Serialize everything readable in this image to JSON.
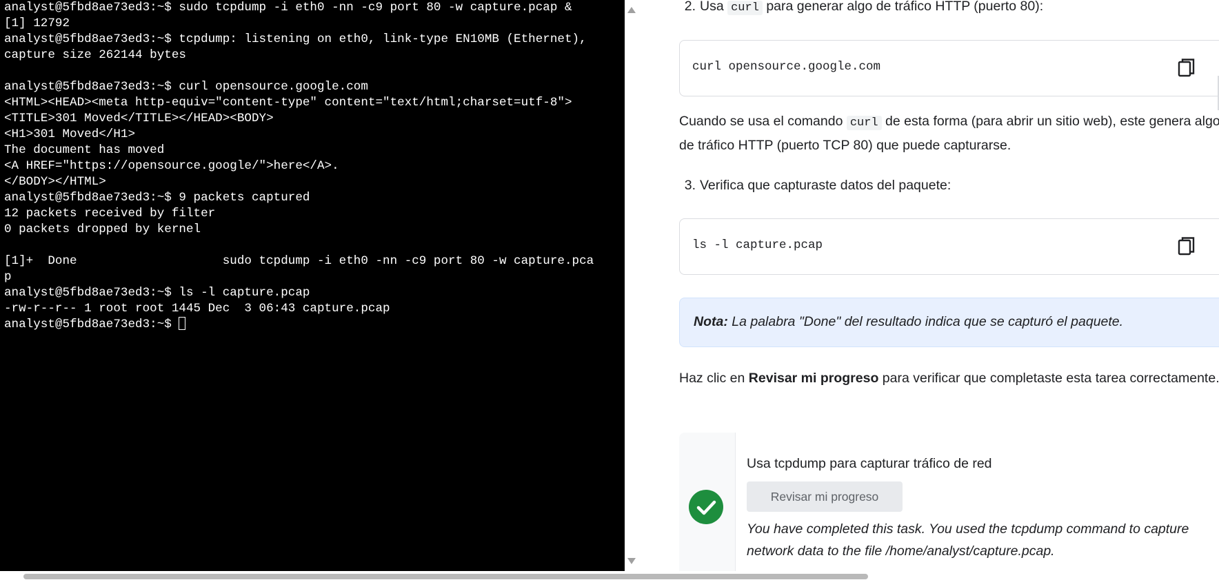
{
  "terminal": {
    "lines": [
      "analyst@5fbd8ae73ed3:~$ sudo tcpdump -i eth0 -nn -c9 port 80 -w capture.pcap &",
      "[1] 12792",
      "analyst@5fbd8ae73ed3:~$ tcpdump: listening on eth0, link-type EN10MB (Ethernet),",
      "capture size 262144 bytes",
      "",
      "analyst@5fbd8ae73ed3:~$ curl opensource.google.com",
      "<HTML><HEAD><meta http-equiv=\"content-type\" content=\"text/html;charset=utf-8\">",
      "<TITLE>301 Moved</TITLE></HEAD><BODY>",
      "<H1>301 Moved</H1>",
      "The document has moved",
      "<A HREF=\"https://opensource.google/\">here</A>.",
      "</BODY></HTML>",
      "analyst@5fbd8ae73ed3:~$ 9 packets captured",
      "12 packets received by filter",
      "0 packets dropped by kernel",
      "",
      "[1]+  Done                    sudo tcpdump -i eth0 -nn -c9 port 80 -w capture.pca",
      "p",
      "analyst@5fbd8ae73ed3:~$ ls -l capture.pcap",
      "-rw-r--r-- 1 root root 1445 Dec  3 06:43 capture.pcap"
    ],
    "prompt": "analyst@5fbd8ae73ed3:~$ "
  },
  "instructions": {
    "step2": {
      "number": "2.",
      "before": "Usa ",
      "code": "curl",
      "after": " para generar algo de tráfico HTTP (puerto 80):"
    },
    "codebox1": "curl opensource.google.com",
    "para1": {
      "before": "Cuando se usa el comando ",
      "code": "curl",
      "after": " de esta forma (para abrir un sitio web), este genera algo de tráfico HTTP (puerto TCP 80) que puede capturarse."
    },
    "step3": {
      "number": "3.",
      "text": "Verifica que capturaste datos del paquete:"
    },
    "codebox2": "ls -l capture.pcap",
    "note": {
      "label": "Nota:",
      "text": " La palabra \"Done\" del resultado indica que se capturó el paquete."
    },
    "progress_para": {
      "before": "Haz clic en ",
      "bold": "Revisar mi progreso",
      "after": " para verificar que completaste esta tarea correctamente."
    },
    "task": {
      "title": "Usa tcpdump para capturar tráfico de red",
      "button": "Revisar mi progreso",
      "message": "You have completed this task. You used the tcpdump command to capture network data to the file /home/analyst/capture.pcap."
    }
  },
  "colors": {
    "terminal_bg": "#000000",
    "terminal_fg": "#ffffff",
    "success_green": "#1e8e3e",
    "note_bg": "#e8f0fe"
  },
  "icons": [
    "copy-icon",
    "check-icon",
    "scroll-up-arrow",
    "scroll-down-arrow"
  ]
}
